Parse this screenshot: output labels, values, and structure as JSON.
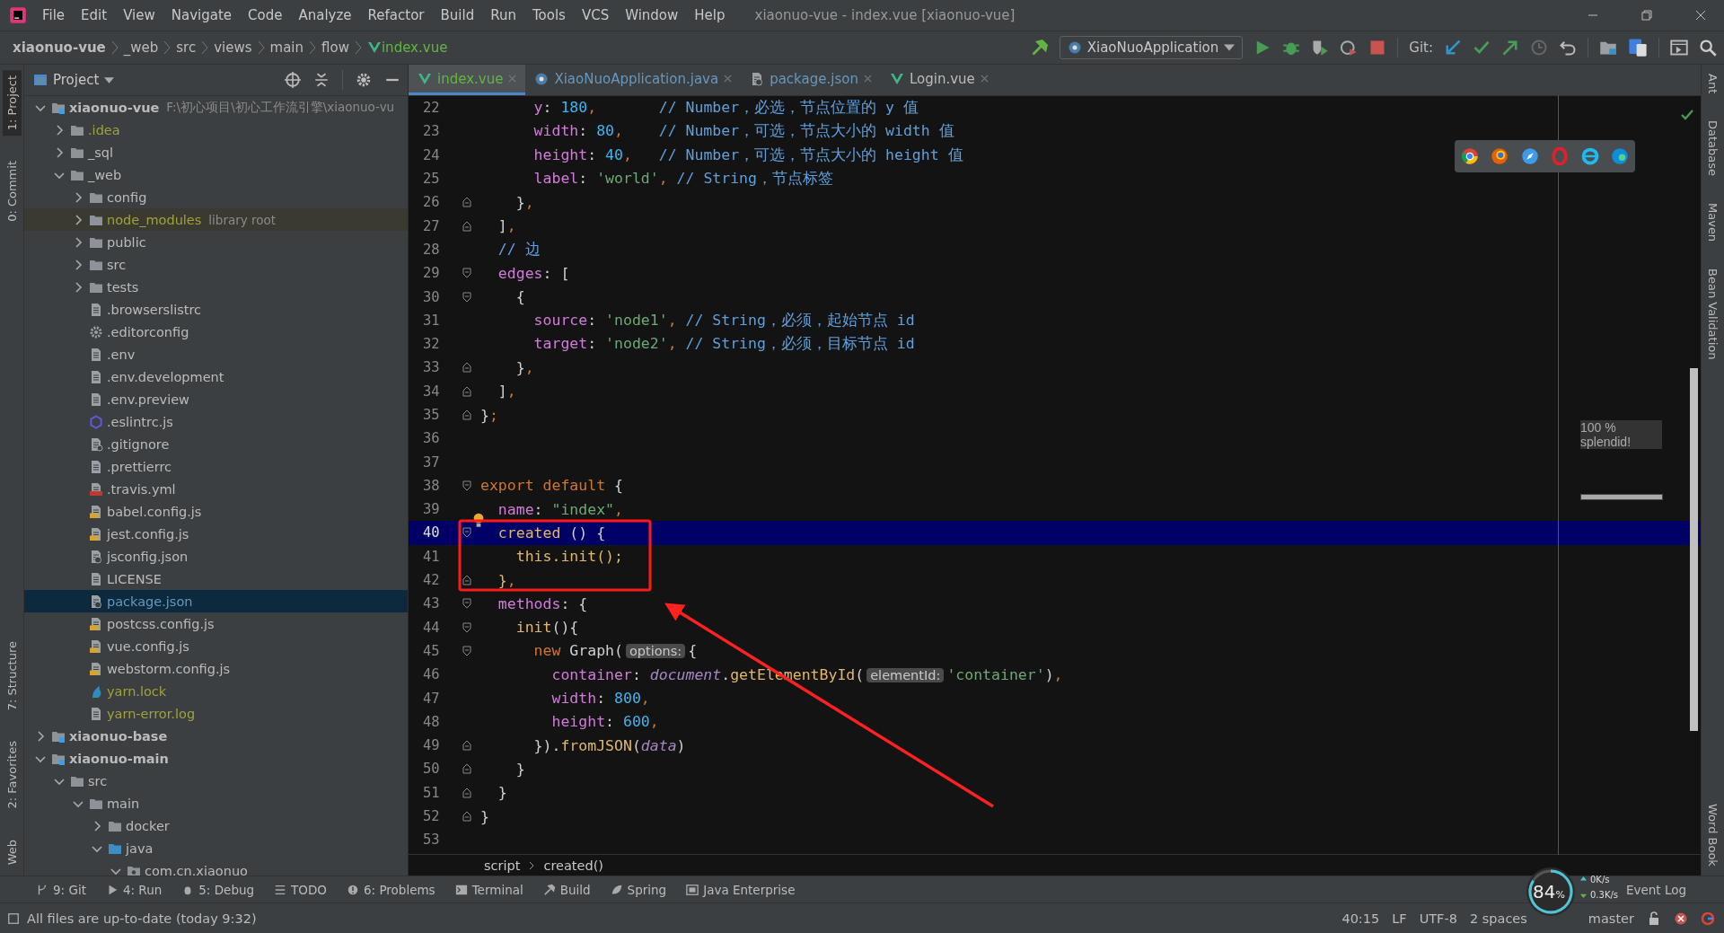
{
  "window": {
    "title": "xiaonuo-vue - index.vue [xiaonuo-vue]"
  },
  "menu": [
    "File",
    "Edit",
    "View",
    "Navigate",
    "Code",
    "Analyze",
    "Refactor",
    "Build",
    "Run",
    "Tools",
    "VCS",
    "Window",
    "Help"
  ],
  "breadcrumb": [
    {
      "label": "xiaonuo-vue",
      "kind": "project"
    },
    {
      "label": "_web",
      "kind": "dir"
    },
    {
      "label": "src",
      "kind": "dir"
    },
    {
      "label": "views",
      "kind": "dir"
    },
    {
      "label": "main",
      "kind": "dir"
    },
    {
      "label": "flow",
      "kind": "dir"
    },
    {
      "label": "index.vue",
      "kind": "vue"
    }
  ],
  "toolbar": {
    "run_config": "XiaoNuoApplication",
    "git_label": "Git:"
  },
  "left_stripe": {
    "top": [
      {
        "label": "1: Project",
        "selected": true
      },
      {
        "label": "0: Commit",
        "selected": false
      }
    ],
    "bottom": [
      {
        "label": "7: Structure",
        "selected": false
      },
      {
        "label": "2: Favorites",
        "selected": false
      },
      {
        "label": "Web",
        "selected": false
      }
    ]
  },
  "right_stripe": {
    "top": [
      {
        "label": "Ant"
      },
      {
        "label": "Database"
      },
      {
        "label": "Maven"
      },
      {
        "label": "Bean Validation"
      }
    ],
    "bottom": [
      {
        "label": "Word Book"
      }
    ]
  },
  "project": {
    "title": "Project",
    "tree": [
      {
        "label": "xiaonuo-vue",
        "kind": "module",
        "hint": "F:\\初心项目\\初心工作流引擎\\xiaonuo-vu",
        "color": "#bbbbbb",
        "selected": false,
        "expanded": true,
        "children": [
          {
            "label": ".idea",
            "kind": "folder",
            "color": "#a1a13b",
            "selected": false,
            "expanded": false
          },
          {
            "label": "_sql",
            "kind": "folder",
            "color": "#bbbbbb",
            "selected": false,
            "expanded": false
          },
          {
            "label": "_web",
            "kind": "folder",
            "color": "#bbbbbb",
            "selected": false,
            "expanded": true,
            "children": [
              {
                "label": "config",
                "kind": "folder",
                "color": "#bbbbbb",
                "selected": false,
                "expanded": false
              },
              {
                "label": "node_modules",
                "kind": "library",
                "hint": "library root",
                "color": "#a1a13b",
                "selected": false,
                "expanded": false
              },
              {
                "label": "public",
                "kind": "folder",
                "color": "#bbbbbb",
                "selected": false,
                "expanded": false
              },
              {
                "label": "src",
                "kind": "folder",
                "color": "#bbbbbb",
                "selected": false,
                "expanded": false
              },
              {
                "label": "tests",
                "kind": "folder",
                "color": "#bbbbbb",
                "selected": false,
                "expanded": false
              },
              {
                "label": ".browserslistrc",
                "kind": "file",
                "color": "#bbbbbb",
                "selected": false
              },
              {
                "label": ".editorconfig",
                "kind": "gear",
                "color": "#bbbbbb",
                "selected": false
              },
              {
                "label": ".env",
                "kind": "file",
                "color": "#bbbbbb",
                "selected": false
              },
              {
                "label": ".env.development",
                "kind": "file",
                "color": "#bbbbbb",
                "selected": false
              },
              {
                "label": ".env.preview",
                "kind": "file",
                "color": "#bbbbbb",
                "selected": false
              },
              {
                "label": ".eslintrc.js",
                "kind": "eslint",
                "color": "#bbbbbb",
                "selected": false
              },
              {
                "label": ".gitignore",
                "kind": "ignore",
                "color": "#bbbbbb",
                "selected": false
              },
              {
                "label": ".prettierrc",
                "kind": "file",
                "color": "#bbbbbb",
                "selected": false
              },
              {
                "label": ".travis.yml",
                "kind": "yml",
                "color": "#bbbbbb",
                "selected": false
              },
              {
                "label": "babel.config.js",
                "kind": "js",
                "color": "#bbbbbb",
                "selected": false
              },
              {
                "label": "jest.config.js",
                "kind": "js",
                "color": "#bbbbbb",
                "selected": false
              },
              {
                "label": "jsconfig.json",
                "kind": "json",
                "color": "#bbbbbb",
                "selected": false
              },
              {
                "label": "LICENSE",
                "kind": "file",
                "color": "#bbbbbb",
                "selected": false
              },
              {
                "label": "package.json",
                "kind": "json",
                "color": "#6897bb",
                "selected": true
              },
              {
                "label": "postcss.config.js",
                "kind": "js",
                "color": "#bbbbbb",
                "selected": false
              },
              {
                "label": "vue.config.js",
                "kind": "js",
                "color": "#bbbbbb",
                "selected": false
              },
              {
                "label": "webstorm.config.js",
                "kind": "js",
                "color": "#bbbbbb",
                "selected": false
              },
              {
                "label": "yarn.lock",
                "kind": "yarn",
                "color": "#a1a13b",
                "selected": false
              },
              {
                "label": "yarn-error.log",
                "kind": "file",
                "color": "#a1a13b",
                "selected": false
              }
            ]
          }
        ]
      },
      {
        "label": "xiaonuo-base",
        "kind": "module",
        "color": "#bbbbbb",
        "selected": false,
        "expanded": false
      },
      {
        "label": "xiaonuo-main",
        "kind": "module",
        "color": "#bbbbbb",
        "selected": false,
        "expanded": true,
        "children": [
          {
            "label": "src",
            "kind": "folder",
            "color": "#bbbbbb",
            "selected": false,
            "expanded": true,
            "children": [
              {
                "label": "main",
                "kind": "folder",
                "color": "#bbbbbb",
                "selected": false,
                "expanded": true,
                "children": [
                  {
                    "label": "docker",
                    "kind": "folder",
                    "color": "#bbbbbb",
                    "selected": false,
                    "expanded": false
                  },
                  {
                    "label": "java",
                    "kind": "source",
                    "color": "#bbbbbb",
                    "selected": false,
                    "expanded": true,
                    "children": [
                      {
                        "label": "com.cn.xiaonuo",
                        "kind": "package",
                        "color": "#bbbbbb",
                        "selected": false,
                        "expanded": true
                      }
                    ]
                  }
                ]
              }
            ]
          }
        ]
      }
    ]
  },
  "tabs": [
    {
      "label": "index.vue",
      "kind": "vue",
      "color": "#62b543",
      "selected": true
    },
    {
      "label": "XiaoNuoApplication.java",
      "kind": "java",
      "color": "#6897bb",
      "selected": false
    },
    {
      "label": "package.json",
      "kind": "json",
      "color": "#6897bb",
      "selected": false
    },
    {
      "label": "Login.vue",
      "kind": "vue",
      "color": "#bbbbbb",
      "selected": false
    }
  ],
  "code": [
    {
      "n": "22",
      "current": false,
      "kind": "plain",
      "tokens": [
        {
          "kind": "key",
          "t": "      y"
        },
        {
          "kind": "p",
          "t": ": "
        },
        {
          "kind": "num",
          "t": "180"
        },
        {
          "kind": "c",
          "t": ",       "
        },
        {
          "kind": "cmt",
          "t": "// Number，必选，节点位置的 y 值"
        }
      ]
    },
    {
      "n": "23",
      "current": false,
      "kind": "plain",
      "tokens": [
        {
          "kind": "key",
          "t": "      width"
        },
        {
          "kind": "p",
          "t": ": "
        },
        {
          "kind": "num",
          "t": "80"
        },
        {
          "kind": "c",
          "t": ",    "
        },
        {
          "kind": "cmt",
          "t": "// Number，可选，节点大小的 width 值"
        }
      ]
    },
    {
      "n": "24",
      "current": false,
      "kind": "plain",
      "tokens": [
        {
          "kind": "key",
          "t": "      height"
        },
        {
          "kind": "p",
          "t": ": "
        },
        {
          "kind": "num",
          "t": "40"
        },
        {
          "kind": "c",
          "t": ",   "
        },
        {
          "kind": "cmt",
          "t": "// Number，可选，节点大小的 height 值"
        }
      ]
    },
    {
      "n": "25",
      "current": false,
      "kind": "plain",
      "tokens": [
        {
          "kind": "key",
          "t": "      label"
        },
        {
          "kind": "p",
          "t": ": "
        },
        {
          "kind": "str",
          "t": "'world'"
        },
        {
          "kind": "c",
          "t": ", "
        },
        {
          "kind": "cmt",
          "t": "// String，节点标签"
        }
      ]
    },
    {
      "n": "26",
      "current": false,
      "kind": "fold_end",
      "tokens": [
        {
          "kind": "p",
          "t": "    }"
        },
        {
          "kind": "c",
          "t": ","
        }
      ]
    },
    {
      "n": "27",
      "current": false,
      "kind": "fold_end",
      "tokens": [
        {
          "kind": "p",
          "t": "  ]"
        },
        {
          "kind": "c",
          "t": ","
        }
      ]
    },
    {
      "n": "28",
      "current": false,
      "kind": "plain",
      "tokens": [
        {
          "kind": "cmt",
          "t": "  // 边"
        }
      ]
    },
    {
      "n": "29",
      "current": false,
      "kind": "fold_start",
      "tokens": [
        {
          "kind": "key",
          "t": "  edges"
        },
        {
          "kind": "p",
          "t": ": ["
        }
      ]
    },
    {
      "n": "30",
      "current": false,
      "kind": "fold_start",
      "tokens": [
        {
          "kind": "p",
          "t": "    {"
        }
      ]
    },
    {
      "n": "31",
      "current": false,
      "kind": "plain",
      "tokens": [
        {
          "kind": "key",
          "t": "      source"
        },
        {
          "kind": "p",
          "t": ": "
        },
        {
          "kind": "str",
          "t": "'node1'"
        },
        {
          "kind": "c",
          "t": ", "
        },
        {
          "kind": "cmt",
          "t": "// String，必须，起始节点 id"
        }
      ]
    },
    {
      "n": "32",
      "current": false,
      "kind": "plain",
      "tokens": [
        {
          "kind": "key",
          "t": "      target"
        },
        {
          "kind": "p",
          "t": ": "
        },
        {
          "kind": "str",
          "t": "'node2'"
        },
        {
          "kind": "c",
          "t": ", "
        },
        {
          "kind": "cmt",
          "t": "// String，必须，目标节点 id"
        }
      ]
    },
    {
      "n": "33",
      "current": false,
      "kind": "fold_end",
      "tokens": [
        {
          "kind": "p",
          "t": "    }"
        },
        {
          "kind": "c",
          "t": ","
        }
      ]
    },
    {
      "n": "34",
      "current": false,
      "kind": "fold_end",
      "tokens": [
        {
          "kind": "p",
          "t": "  ]"
        },
        {
          "kind": "c",
          "t": ","
        }
      ]
    },
    {
      "n": "35",
      "current": false,
      "kind": "fold_end",
      "tokens": [
        {
          "kind": "p",
          "t": "}"
        },
        {
          "kind": "c",
          "t": ";"
        }
      ]
    },
    {
      "n": "36",
      "current": false,
      "kind": "plain"
    },
    {
      "n": "37",
      "current": false,
      "kind": "plain"
    },
    {
      "n": "38",
      "current": false,
      "kind": "fold_start",
      "tokens": [
        {
          "kind": "kw",
          "t": "export default"
        },
        {
          "kind": "p",
          "t": " {"
        }
      ]
    },
    {
      "n": "39",
      "current": false,
      "kind": "plain",
      "bulb": true,
      "tokens": [
        {
          "kind": "key",
          "t": "  name"
        },
        {
          "kind": "p",
          "t": ": "
        },
        {
          "kind": "str",
          "t": "\"index\""
        },
        {
          "kind": "c",
          "t": ","
        }
      ]
    },
    {
      "n": "40",
      "current": true,
      "kind": "fold_start",
      "tokens": [
        {
          "kind": "fn",
          "t": "  created"
        },
        {
          "kind": "p",
          "t": " () {"
        }
      ]
    },
    {
      "n": "41",
      "current": false,
      "kind": "plain",
      "tokens": [
        {
          "kind": "fn",
          "t": "    this.init();"
        }
      ]
    },
    {
      "n": "42",
      "current": false,
      "kind": "fold_end",
      "tokens": [
        {
          "kind": "fn",
          "t": "  }"
        },
        {
          "kind": "c",
          "t": ","
        }
      ]
    },
    {
      "n": "43",
      "current": false,
      "kind": "fold_start",
      "tokens": [
        {
          "kind": "key",
          "t": "  methods"
        },
        {
          "kind": "p",
          "t": ": {"
        }
      ]
    },
    {
      "n": "44",
      "current": false,
      "kind": "fold_start",
      "tokens": [
        {
          "kind": "fn",
          "t": "    init"
        },
        {
          "kind": "p",
          "t": "(){"
        }
      ]
    },
    {
      "n": "45",
      "current": false,
      "kind": "fold_start",
      "tokens": [
        {
          "kind": "kw",
          "t": "      new"
        },
        {
          "kind": "p",
          "t": " Graph("
        },
        {
          "kind": "hint",
          "t": "options:"
        },
        {
          "kind": "p",
          "t": "{"
        }
      ]
    },
    {
      "n": "46",
      "current": false,
      "kind": "plain",
      "tokens": [
        {
          "kind": "key",
          "t": "        container"
        },
        {
          "kind": "p",
          "t": ": "
        },
        {
          "kind": "it",
          "t": "document"
        },
        {
          "kind": "p",
          "t": "."
        },
        {
          "kind": "fn",
          "t": "getElementById"
        },
        {
          "kind": "p",
          "t": "("
        },
        {
          "kind": "hint",
          "t": "elementId:"
        },
        {
          "kind": "str",
          "t": "'container'"
        },
        {
          "kind": "p",
          "t": ")"
        },
        {
          "kind": "c",
          "t": ","
        }
      ]
    },
    {
      "n": "47",
      "current": false,
      "kind": "plain",
      "tokens": [
        {
          "kind": "key",
          "t": "        width"
        },
        {
          "kind": "p",
          "t": ": "
        },
        {
          "kind": "num",
          "t": "800"
        },
        {
          "kind": "c",
          "t": ","
        }
      ]
    },
    {
      "n": "48",
      "current": false,
      "kind": "plain",
      "tokens": [
        {
          "kind": "key",
          "t": "        height"
        },
        {
          "kind": "p",
          "t": ": "
        },
        {
          "kind": "num",
          "t": "600"
        },
        {
          "kind": "c",
          "t": ","
        }
      ]
    },
    {
      "n": "49",
      "current": false,
      "kind": "fold_end",
      "tokens": [
        {
          "kind": "p",
          "t": "      })."
        },
        {
          "kind": "fn",
          "t": "fromJSON"
        },
        {
          "kind": "p",
          "t": "("
        },
        {
          "kind": "it",
          "t": "data"
        },
        {
          "kind": "p",
          "t": ")"
        }
      ]
    },
    {
      "n": "50",
      "current": false,
      "kind": "fold_end",
      "tokens": [
        {
          "kind": "p",
          "t": "    }"
        }
      ]
    },
    {
      "n": "51",
      "current": false,
      "kind": "fold_end",
      "tokens": [
        {
          "kind": "p",
          "t": "  }"
        }
      ]
    },
    {
      "n": "52",
      "current": false,
      "kind": "fold_end",
      "tokens": [
        {
          "kind": "p",
          "t": "}"
        }
      ]
    },
    {
      "n": "53",
      "current": false,
      "kind": "plain"
    }
  ],
  "editor_overlay": {
    "coverage": "100 %",
    "verdict": "splendid!"
  },
  "editor_breadcrumb": [
    "script",
    "created()"
  ],
  "tool_windows": [
    {
      "label": "9: Git",
      "kind": "git"
    },
    {
      "label": "4: Run",
      "kind": "run"
    },
    {
      "label": "5: Debug",
      "kind": "debug"
    },
    {
      "label": "TODO",
      "kind": "todo"
    },
    {
      "label": "6: Problems",
      "kind": "problems"
    },
    {
      "label": "Terminal",
      "kind": "terminal"
    },
    {
      "label": "Build",
      "kind": "build"
    },
    {
      "label": "Spring",
      "kind": "spring"
    },
    {
      "label": "Java Enterprise",
      "kind": "javaee"
    }
  ],
  "event_log": "Event Log",
  "net_monitor": {
    "percent": "84",
    "unit": "%",
    "level": 0.84,
    "upload": "0K/s",
    "download": "0.3K/s"
  },
  "status_bar": {
    "message": "All files are up-to-date (today 9:32)",
    "position": "40:15",
    "line_sep": "LF",
    "encoding": "UTF-8",
    "indent": "2 spaces",
    "branch": "master"
  }
}
